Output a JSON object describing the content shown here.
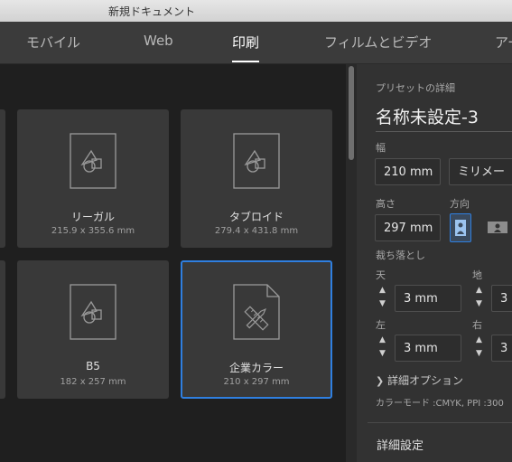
{
  "window": {
    "title": "新規ドキュメント"
  },
  "tabs": [
    {
      "label": "モバイル"
    },
    {
      "label": "Web"
    },
    {
      "label": "印刷"
    },
    {
      "label": "フィルムとビデオ"
    },
    {
      "label": "アー"
    }
  ],
  "active_tab": "印刷",
  "presets": [
    {
      "name": "リーガル",
      "size": "215.9 x 355.6 mm",
      "icon": "shapes-document-icon"
    },
    {
      "name": "タブロイド",
      "size": "279.4 x 431.8 mm",
      "icon": "shapes-document-icon"
    },
    {
      "name": "B5",
      "size": "182 x 257 mm",
      "icon": "shapes-document-icon"
    },
    {
      "name": "企業カラー",
      "size": "210 x 297 mm",
      "icon": "pencil-ruler-document-icon",
      "selected": true
    }
  ],
  "details": {
    "header": "プリセットの詳細",
    "doc_name": "名称未設定-3",
    "width_label": "幅",
    "width_value": "210 mm",
    "unit_value": "ミリメー",
    "height_label": "高さ",
    "height_value": "297 mm",
    "orientation_label": "方向",
    "bleed_label": "裁ち落とし",
    "top_label": "天",
    "top_value": "3 mm",
    "bottom_label": "地",
    "bottom_value": "3",
    "left_label": "左",
    "left_value": "3 mm",
    "right_label": "右",
    "right_value": "3",
    "advanced_options": "詳細オプション",
    "color_mode": "カラーモード :CMYK, PPI :300",
    "detail_settings": "詳細設定"
  },
  "colors": {
    "accent": "#2f7fe0",
    "panel": "#323232",
    "card": "#393939"
  }
}
